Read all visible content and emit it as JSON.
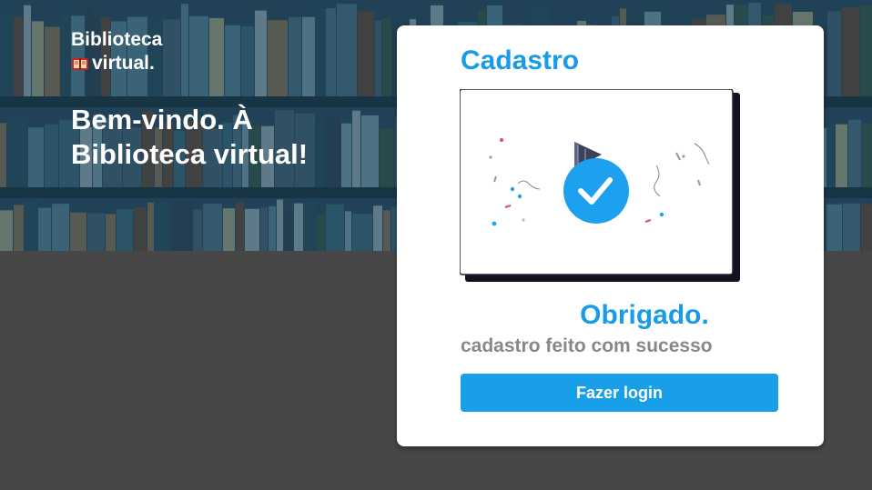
{
  "brand": {
    "line1": "Biblioteca",
    "line2": "virtual.",
    "icon": "book-icon"
  },
  "welcome": {
    "text": "Bem-vindo. À Biblioteca virtual!"
  },
  "card": {
    "title": "Cadastro",
    "illustration": "success-check-icon",
    "thanks": "Obrigado.",
    "subtitle": "cadastro feito com sucesso",
    "button_label": "Fazer login"
  },
  "colors": {
    "accent": "#1a9be6",
    "button": "#199ee8",
    "subtitle": "#888888",
    "background": "#474747"
  }
}
